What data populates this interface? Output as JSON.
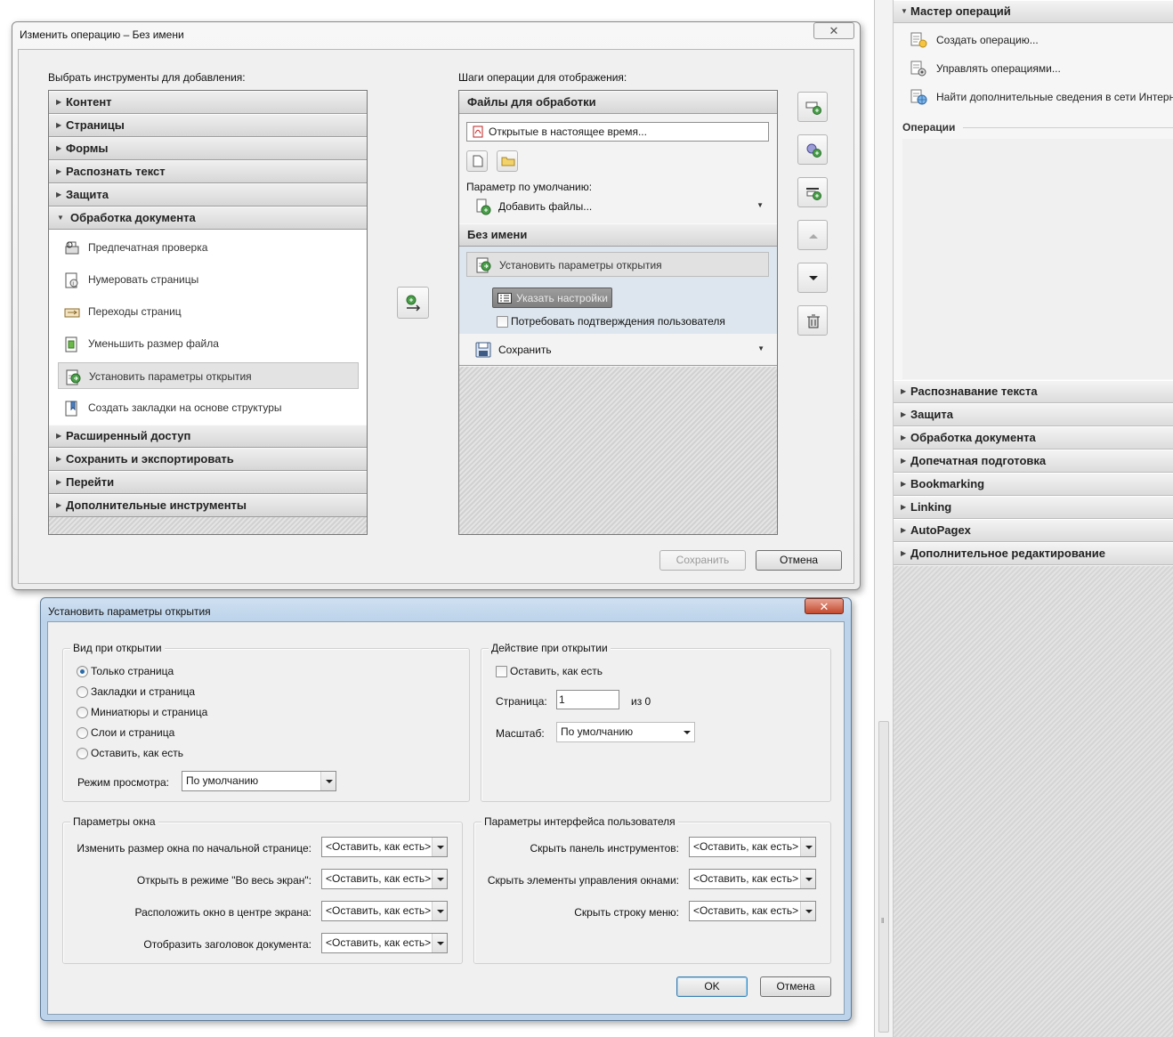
{
  "right_panel": {
    "header": "Мастер операций",
    "items": [
      "Создать операцию...",
      "Управлять операциями...",
      "Найти дополнительные сведения в сети Интерн..."
    ],
    "operations_label": "Операции",
    "sections": [
      "Распознавание текста",
      "Защита",
      "Обработка документа",
      "Допечатная подготовка",
      "Bookmarking",
      "Linking",
      "AutoPagex",
      "Дополнительное редактирование"
    ]
  },
  "dialog1": {
    "title": "Изменить операцию – Без имени",
    "close_glyph": "✕",
    "left_label": "Выбрать инструменты для добавления:",
    "categories_top": [
      "Контент",
      "Страницы",
      "Формы",
      "Распознать текст",
      "Защита"
    ],
    "expanded_category": "Обработка документа",
    "tools": [
      "Предпечатная проверка",
      "Нумеровать страницы",
      "Переходы страниц",
      "Уменьшить размер файла",
      "Установить параметры открытия",
      "Создать закладки на основе структуры"
    ],
    "categories_bottom": [
      "Расширенный доступ",
      "Сохранить и экспортировать",
      "Перейти",
      "Дополнительные инструменты"
    ],
    "right_label": "Шаги операции для отображения:",
    "files_header": "Файлы для обработки",
    "files_value": "Открытые в настоящее время...",
    "default_param_label": "Параметр по умолчанию:",
    "add_files": "Добавить файлы...",
    "unnamed_header": "Без имени",
    "step_label": "Установить параметры открытия",
    "specify_settings": "Указать настройки",
    "require_confirm": "Потребовать подтверждения пользователя",
    "save_step": "Сохранить",
    "save_button": "Сохранить",
    "cancel_button": "Отмена"
  },
  "dialog2": {
    "title": "Установить параметры открытия",
    "close_glyph": "✕",
    "open_view": {
      "title": "Вид при открытии",
      "options": [
        "Только страница",
        "Закладки и страница",
        "Миниатюры и страница",
        "Слои и страница",
        "Оставить, как есть"
      ],
      "selected_index": 0,
      "view_mode_label": "Режим просмотра:",
      "view_mode_value": "По умолчанию"
    },
    "open_action": {
      "title": "Действие при открытии",
      "keep_as_is": "Оставить, как есть",
      "page_label": "Страница:",
      "page_value": "1",
      "of_label": "из 0",
      "zoom_label": "Масштаб:",
      "zoom_value": "По умолчанию"
    },
    "window_params": {
      "title": "Параметры окна",
      "rows": [
        {
          "label": "Изменить размер окна по начальной странице:",
          "value": "<Оставить, как есть>"
        },
        {
          "label": "Открыть в режиме \"Во весь экран\":",
          "value": "<Оставить, как есть>"
        },
        {
          "label": "Расположить окно в центре экрана:",
          "value": "<Оставить, как есть>"
        },
        {
          "label": "Отобразить заголовок документа:",
          "value": "<Оставить, как есть>"
        }
      ]
    },
    "ui_params": {
      "title": "Параметры интерфейса пользователя",
      "rows": [
        {
          "label": "Скрыть панель инструментов:",
          "value": "<Оставить, как есть>"
        },
        {
          "label": "Скрыть элементы управления окнами:",
          "value": "<Оставить, как есть>"
        },
        {
          "label": "Скрыть строку меню:",
          "value": "<Оставить, как есть>"
        }
      ]
    },
    "ok_button": "OK",
    "cancel_button": "Отмена"
  }
}
